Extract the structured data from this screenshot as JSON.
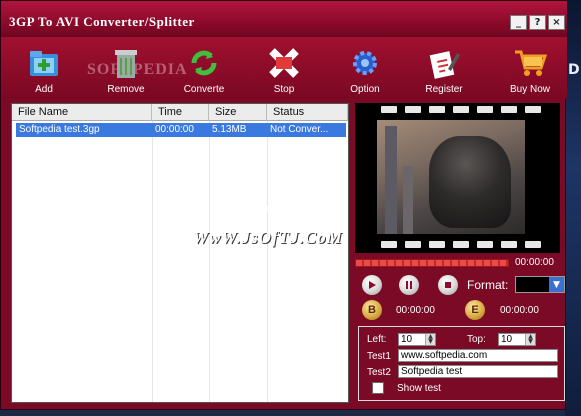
{
  "window": {
    "title": "3GP To AVI Converter/Splitter",
    "buttons": [
      "_",
      "?",
      "×"
    ]
  },
  "watermark": "SOFTPEDIA",
  "toolbar": {
    "items": [
      {
        "label": "Add",
        "icon": "add-folder-icon"
      },
      {
        "label": "Remove",
        "icon": "trash-icon"
      },
      {
        "label": "Converte",
        "icon": "refresh-icon"
      },
      {
        "label": "Stop",
        "icon": "stop-icon"
      },
      {
        "label": "Option",
        "icon": "gear-icon"
      },
      {
        "label": "Register",
        "icon": "register-pen-icon"
      },
      {
        "label": "Buy Now",
        "icon": "cart-icon"
      }
    ]
  },
  "filelist": {
    "columns": [
      "File Name",
      "Time",
      "Size",
      "Status"
    ],
    "rows": [
      {
        "name": "Softpedia test.3gp",
        "time": "00:00:00",
        "size": "5.13MB",
        "status": "Not Conver..."
      }
    ]
  },
  "overlay": {
    "line1": "JSOFTJ.COM",
    "line2": "WwW.JsOfTJ.CoM"
  },
  "player": {
    "time": "00:00:00",
    "format_label": "Format:",
    "format_value": "",
    "begin_label": "B",
    "begin_time": "00:00:00",
    "end_label": "E",
    "end_time": "00:00:00"
  },
  "options": {
    "left_label": "Left:",
    "left_value": "10",
    "top_label": "Top:",
    "top_value": "10",
    "test1_label": "Test1",
    "test1_value": "www.softpedia.com",
    "test2_label": "Test2",
    "test2_value": "Softpedia test",
    "show_label": "Show test"
  },
  "colors": {
    "accent": "#8c0a2b",
    "selection": "#3a7ae0",
    "progress": "#e64a4a"
  }
}
